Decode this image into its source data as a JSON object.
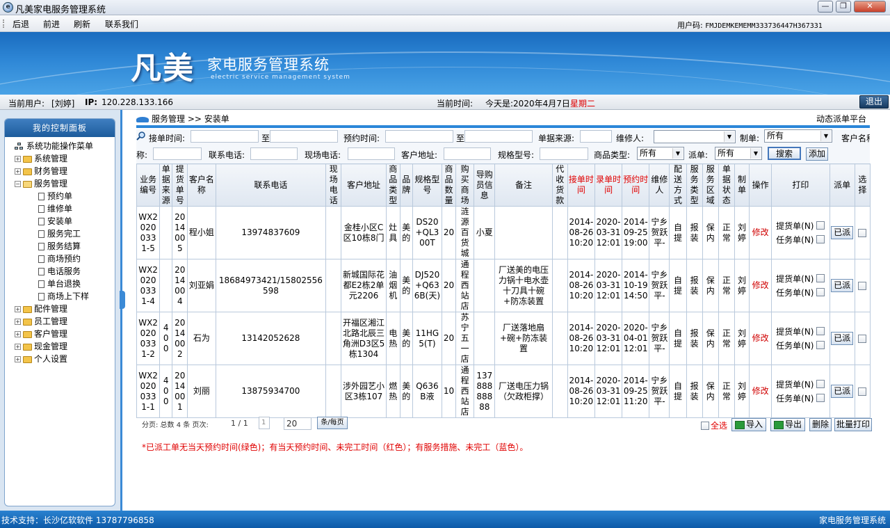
{
  "window": {
    "title": "凡美家电服务管理系统",
    "icon_glyph": "e",
    "btn_min": "—",
    "btn_max": "❐",
    "btn_close": "✕"
  },
  "menubar": {
    "items": [
      "后退",
      "前进",
      "刷新",
      "联系我们"
    ],
    "user_code_label": "用户码:",
    "user_code": "FMJDEMKEMEMM333736447H367331"
  },
  "banner": {
    "logo": "凡美",
    "system_name": "家电服务管理系统",
    "system_sub": "electric service management system"
  },
  "infobar": {
    "current_user_label": "当前用户:",
    "current_user": "[刘婷]",
    "ip_label": "IP:",
    "ip": "120.228.133.166",
    "current_time_label": "当前时间:",
    "date_text": "今天是:2020年4月7日",
    "weekday": "星期二",
    "logout": "退出"
  },
  "sidebar": {
    "title": "我的控制面板",
    "root": "系统功能操作菜单",
    "groups_top": [
      "系统管理",
      "财务管理"
    ],
    "open_group": "服务管理",
    "sub_items": [
      "预约单",
      "维修单",
      "安装单",
      "服务完工",
      "服务结算",
      "商场预约",
      "电话服务",
      "单台退换",
      "商场上下样"
    ],
    "groups_bottom": [
      "配件管理",
      "员工管理",
      "客户管理",
      "现金管理",
      "个人设置"
    ]
  },
  "breadcrumb": {
    "section": "服务管理",
    "page": ">> 安装单",
    "right": "动态派单平台"
  },
  "filters": {
    "receive_time": "接单时间:",
    "to1": "至",
    "appoint_time": "预约时间:",
    "to2": "至",
    "source": "单据来源:",
    "repairer": "维修人:",
    "maker": "制单:",
    "maker_value": "所有",
    "customer_name": "客户名称:",
    "contact_phone": "联系电话:",
    "site_phone": "现场电话:",
    "customer_address": "客户地址:",
    "model": "规格型号:",
    "product_type": "商品类型:",
    "product_type_value": "所有",
    "dispatch": "派单:",
    "dispatch_value": "所有",
    "search_btn": "搜索",
    "add_btn": "添加"
  },
  "table": {
    "headers": [
      "业务编号",
      "单据来源",
      "提货单号",
      "客户名称",
      "联系电话",
      "现场电话",
      "客户地址",
      "商品类型",
      "品牌",
      "规格型号",
      "商品数量",
      "购买商场",
      "导购员信息",
      "备注",
      "代收货款",
      "接单时间",
      "录单时间",
      "预约时间",
      "维修人",
      "配送方式",
      "服务类型",
      "服务区域",
      "单据状态",
      "制单",
      "操作",
      "打印",
      "派单",
      "选择"
    ],
    "print_labels": [
      "提货单(N)",
      "任务单(N)"
    ],
    "modify": "修改",
    "dispatched": "已派",
    "rows": [
      {
        "id": "WX20200331-5",
        "source": "",
        "pickup": "2014005",
        "name": "程小姐",
        "phone": "13974837609",
        "site_phone": "",
        "addr": "金桂小区C区10栋8门",
        "type": "灶具",
        "brand": "美的",
        "model": "DS20+QL300T",
        "qty": "20",
        "mall": "涟源百货城",
        "guide": "小夏",
        "remark": "",
        "cod": "",
        "recv": "2014-08-26 10:20",
        "entry": "2020-03-31 12:01",
        "appoint": "2014-09-25 19:00",
        "repairer": "宁乡贺跃平-",
        "delivery": "自提",
        "svc": "报装",
        "area": "保内",
        "status": "正常",
        "maker": "刘婷"
      },
      {
        "id": "WX20200331-4",
        "source": "",
        "pickup": "2014004",
        "name": "刘亚娟",
        "phone": "18684973421/15802556598",
        "site_phone": "",
        "addr": "新城国际花都E2栋2单元2206",
        "type": "油烟机",
        "brand": "美的",
        "model": "DJ520+Q636B(天)",
        "qty": "20",
        "mall": "通程西站店",
        "guide": "",
        "remark": "厂送美的电压力锅十电水壶十刀具十碗+防冻装置",
        "cod": "",
        "recv": "2014-08-26 10:20",
        "entry": "2020-03-31 12:01",
        "appoint": "2014-10-19 14:50",
        "repairer": "宁乡贺跃平-",
        "delivery": "自提",
        "svc": "报装",
        "area": "保内",
        "status": "正常",
        "maker": "刘婷"
      },
      {
        "id": "WX20200331-2",
        "source": "400",
        "pickup": "2014002",
        "name": "石为",
        "phone": "13142052628",
        "site_phone": "",
        "addr": "开福区湘江北路北辰三角洲D3区5栋1304",
        "type": "电热",
        "brand": "美的",
        "model": "11HG5(T)",
        "qty": "20",
        "mall": "苏宁五一店",
        "guide": "",
        "remark": "厂送落地扇+碗+防冻装置",
        "cod": "",
        "recv": "2014-08-26 10:20",
        "entry": "2020-03-31 12:01",
        "appoint": "2020-04-01 12:01",
        "repairer": "宁乡贺跃平-",
        "delivery": "自提",
        "svc": "报装",
        "area": "保内",
        "status": "正常",
        "maker": "刘婷"
      },
      {
        "id": "WX20200331-1",
        "source": "400",
        "pickup": "2014001",
        "name": "刘丽",
        "phone": "13875934700",
        "site_phone": "",
        "addr": "涉外园艺小区3栋107",
        "type": "燃热",
        "brand": "美的",
        "model": "Q636B液",
        "qty": "10",
        "mall": "通程西站店",
        "guide": "13788888888",
        "remark": "厂送电压力锅（欠政柜撑）",
        "cod": "",
        "recv": "2014-08-26 10:20",
        "entry": "2020-03-31 12:01",
        "appoint": "2014-09-25 11:20",
        "repairer": "宁乡贺跃平-",
        "delivery": "自提",
        "svc": "报装",
        "area": "保内",
        "status": "正常",
        "maker": "刘婷"
      }
    ]
  },
  "pager": {
    "text": "分页: 总数 4 条  页次: ",
    "page_info": "1 / 1",
    "page_input": "1",
    "page_size": "20",
    "per_page_btn": "条/每页"
  },
  "actions": {
    "select_all": "全选",
    "import": "导入",
    "export": "导出",
    "delete": "删除",
    "batch_print": "批量打印"
  },
  "note": "*已派工单无当天预约时间(绿色)；有当天预约时间、未完工时间（红色）；有服务措施、未完工（蓝色）。",
  "footer": {
    "left": "技术支持：长沙亿软软件 13787796858",
    "right": "家电服务管理系统"
  }
}
